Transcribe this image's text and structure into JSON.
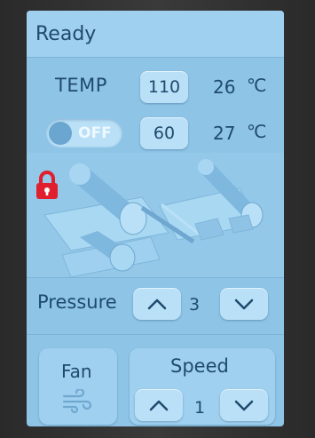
{
  "status": {
    "text": "Ready"
  },
  "temp_row": {
    "label": "TEMP",
    "setpoint": "110",
    "reading": "26",
    "unit": "℃"
  },
  "heater_row": {
    "toggle_label": "OFF",
    "toggle_state": "off",
    "setpoint": "60",
    "reading": "27",
    "unit": "℃"
  },
  "lock": {
    "icon": "lock-icon",
    "state": "locked",
    "color": "#e0202e"
  },
  "pressure": {
    "label": "Pressure",
    "value": "3"
  },
  "fan": {
    "label": "Fan",
    "icon": "fan-icon"
  },
  "speed": {
    "label": "Speed",
    "value": "1"
  },
  "colors": {
    "screen": "#8ec4e6",
    "button": "#b9e0f7",
    "text": "#1f4a6e"
  }
}
